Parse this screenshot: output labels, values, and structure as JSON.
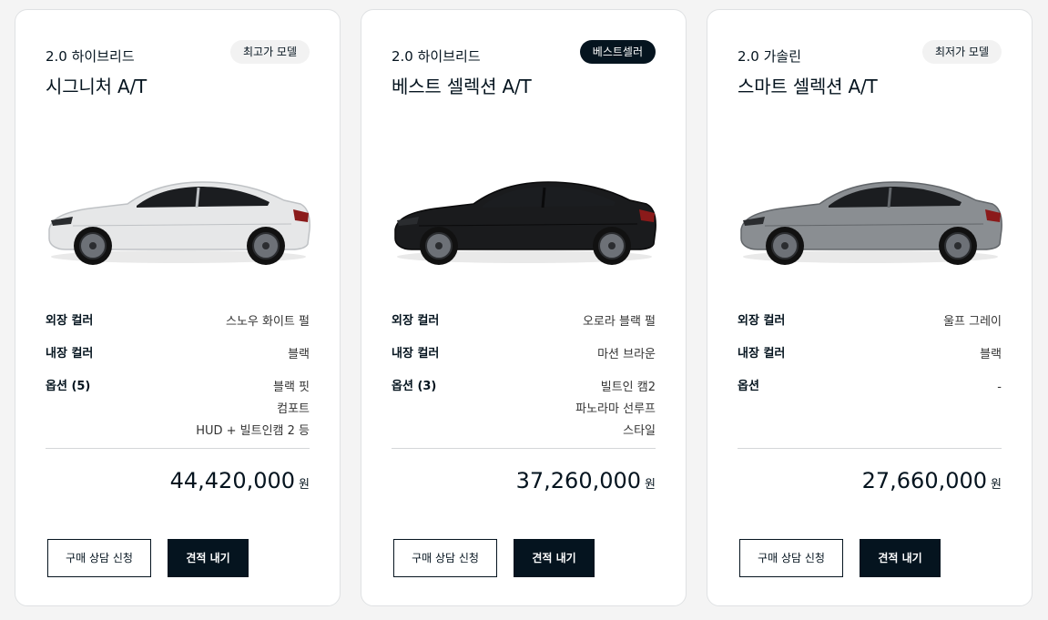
{
  "cards": [
    {
      "engine": "2.0 하이브리드",
      "trim": "시그니처 A/T",
      "badge": "최고가 모델",
      "badge_style": "light",
      "car_color": "#e6e7e8",
      "car_shade": "#bfc2c5",
      "specs": {
        "exterior_label": "외장 컬러",
        "exterior_value": "스노우 화이트 펄",
        "interior_label": "내장 컬러",
        "interior_value": "블랙",
        "options_label": "옵션 (5)",
        "options_values": [
          "블랙 핏",
          "컴포트",
          "HUD + 빌트인캠 2 등"
        ]
      },
      "price": "44,420,000",
      "price_unit": "원",
      "consult_label": "구매 상담 신청",
      "quote_label": "견적 내기"
    },
    {
      "engine": "2.0 하이브리드",
      "trim": "베스트 셀렉션 A/T",
      "badge": "베스트셀러",
      "badge_style": "dark",
      "car_color": "#1a1b1d",
      "car_shade": "#0a0a0b",
      "specs": {
        "exterior_label": "외장 컬러",
        "exterior_value": "오로라 블랙 펄",
        "interior_label": "내장 컬러",
        "interior_value": "마션 브라운",
        "options_label": "옵션 (3)",
        "options_values": [
          "빌트인 캠2",
          "파노라마 선루프",
          "스타일"
        ]
      },
      "price": "37,260,000",
      "price_unit": "원",
      "consult_label": "구매 상담 신청",
      "quote_label": "견적 내기"
    },
    {
      "engine": "2.0 가솔린",
      "trim": "스마트 셀렉션 A/T",
      "badge": "최저가 모델",
      "badge_style": "light",
      "car_color": "#8a8e92",
      "car_shade": "#62666a",
      "specs": {
        "exterior_label": "외장 컬러",
        "exterior_value": "울프 그레이",
        "interior_label": "내장 컬러",
        "interior_value": "블랙",
        "options_label": "옵션",
        "options_values": [
          "-"
        ]
      },
      "price": "27,660,000",
      "price_unit": "원",
      "consult_label": "구매 상담 신청",
      "quote_label": "견적 내기"
    }
  ]
}
